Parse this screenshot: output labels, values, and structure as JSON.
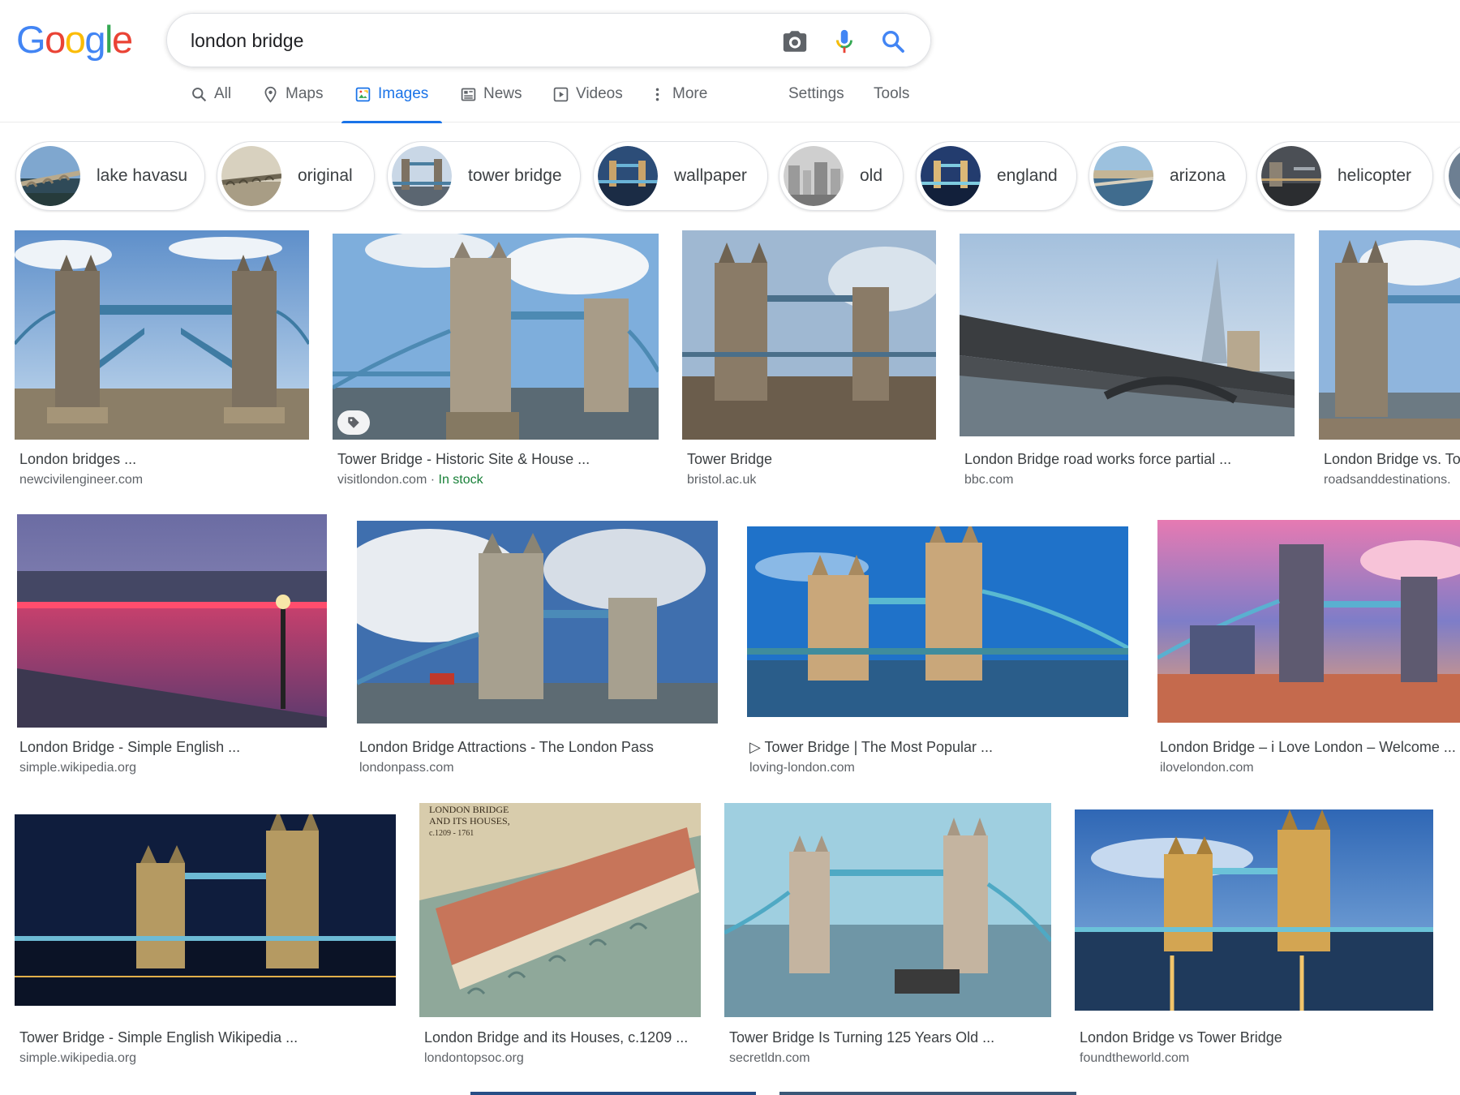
{
  "logo": {
    "letters": [
      "G",
      "o",
      "o",
      "g",
      "l",
      "e"
    ],
    "colors": [
      "#4285f4",
      "#ea4335",
      "#fbbc05",
      "#4285f4",
      "#34a853",
      "#ea4335"
    ]
  },
  "search": {
    "query": "london bridge"
  },
  "tabs": [
    {
      "label": "All",
      "icon": "search-icon"
    },
    {
      "label": "Maps",
      "icon": "map-pin-icon"
    },
    {
      "label": "Images",
      "icon": "image-icon",
      "active": true
    },
    {
      "label": "News",
      "icon": "newspaper-icon"
    },
    {
      "label": "Videos",
      "icon": "play-icon"
    },
    {
      "label": "More",
      "icon": "more-vert-icon"
    },
    {
      "label": "Settings"
    },
    {
      "label": "Tools"
    }
  ],
  "chips": [
    {
      "label": "lake havasu"
    },
    {
      "label": "original"
    },
    {
      "label": "tower bridge"
    },
    {
      "label": "wallpaper"
    },
    {
      "label": "old"
    },
    {
      "label": "england"
    },
    {
      "label": "arizona"
    },
    {
      "label": "helicopter"
    }
  ],
  "results": [
    {
      "title": "London bridges ...",
      "source": "newcivilengineer.com"
    },
    {
      "title": "Tower Bridge - Historic Site & House ...",
      "source": "visitlondon.com",
      "stock": "In stock"
    },
    {
      "title": "Tower Bridge",
      "source": "bristol.ac.uk"
    },
    {
      "title": "London Bridge road works force partial ...",
      "source": "bbc.com"
    },
    {
      "title": "London Bridge vs. To",
      "source": "roadsanddestinations."
    },
    {
      "title": "London Bridge - Simple English ...",
      "source": "simple.wikipedia.org"
    },
    {
      "title": "London Bridge Attractions - The London Pass",
      "source": "londonpass.com"
    },
    {
      "title": "▷ Tower Bridge | The Most Popular ...",
      "source": "loving-london.com"
    },
    {
      "title": "London Bridge – i Love London – Welcome ...",
      "source": "ilovelondon.com"
    },
    {
      "title": "Tower Bridge - Simple English Wikipedia ...",
      "source": "simple.wikipedia.org"
    },
    {
      "title": "London Bridge and its Houses, c.1209 ...",
      "source": "londontopsoc.org"
    },
    {
      "title": "Tower Bridge Is Turning 125 Years Old ...",
      "source": "secretldn.com"
    },
    {
      "title": "London Bridge vs Tower Bridge",
      "source": "foundtheworld.com"
    }
  ],
  "map_caption": {
    "line1": "LONDON BRIDGE",
    "line2": "AND ITS HOUSES,",
    "line3": "c.1209 - 1761"
  },
  "colors": {
    "accent": "#1a73e8",
    "stock": "#188038"
  }
}
